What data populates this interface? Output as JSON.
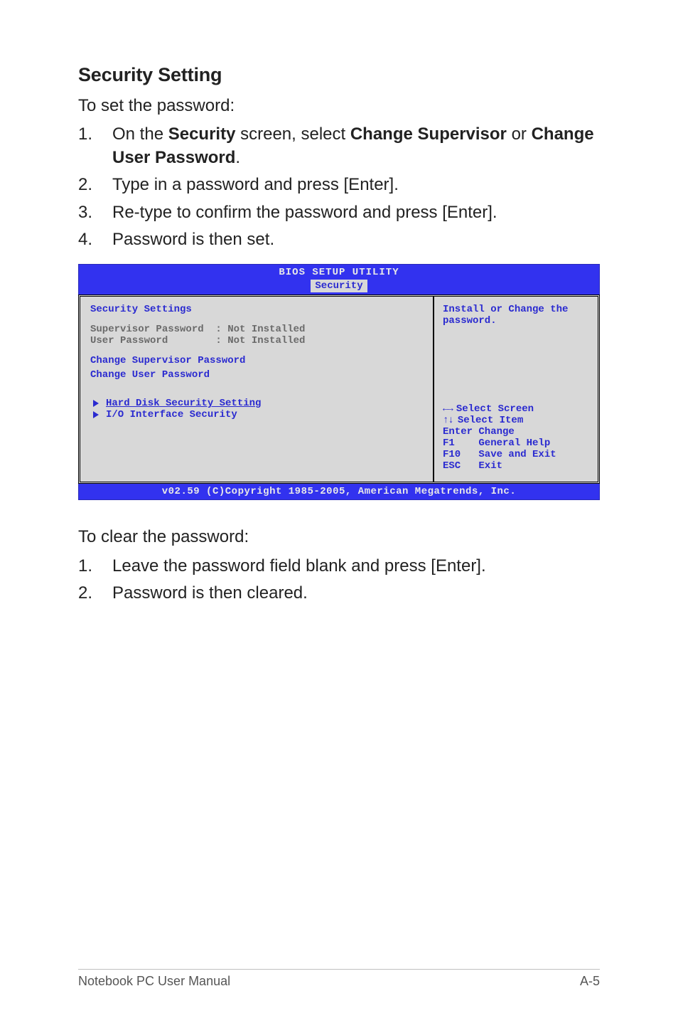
{
  "heading": "Security Setting",
  "intro": "To set the password:",
  "steps_set": [
    {
      "num": "1.",
      "pre": "On the ",
      "b1": "Security",
      "mid": " screen, select ",
      "b2": "Change Supervisor",
      "mid2": " or ",
      "b3": "Change User Password",
      "post": "."
    },
    {
      "num": "2.",
      "text": "Type in a password and press [Enter]."
    },
    {
      "num": "3.",
      "text": "Re-type to confirm the password and press [Enter]."
    },
    {
      "num": "4.",
      "text": "Password is then set."
    }
  ],
  "bios": {
    "title": "BIOS SETUP UTILITY",
    "tab": "Security",
    "section_title": "Security Settings",
    "rows": [
      "Supervisor Password  : Not Installed",
      "User Password        : Not Installed"
    ],
    "links": [
      "Change Supervisor Password",
      "Change User Password"
    ],
    "subs": [
      "Hard Disk Security Setting",
      "I/O Interface Security"
    ],
    "help_top": "Install or Change the password.",
    "help_keys": [
      {
        "class": "arrows-lr",
        "label": "Select Screen"
      },
      {
        "class": "arrows-ud",
        "label": "Select Item"
      },
      {
        "key": "Enter",
        "label": "Change"
      },
      {
        "key": "F1   ",
        "label": "General Help"
      },
      {
        "key": "F10  ",
        "label": "Save and Exit"
      },
      {
        "key": "ESC  ",
        "label": "Exit"
      }
    ],
    "footer": "v02.59 (C)Copyright 1985-2005, American Megatrends, Inc."
  },
  "intro2": "To clear the password:",
  "steps_clear": [
    {
      "num": "1.",
      "text": "Leave the password field blank and press [Enter]."
    },
    {
      "num": "2.",
      "text": "Password is then cleared."
    }
  ],
  "footer_left": "Notebook PC User Manual",
  "footer_right": "A-5"
}
